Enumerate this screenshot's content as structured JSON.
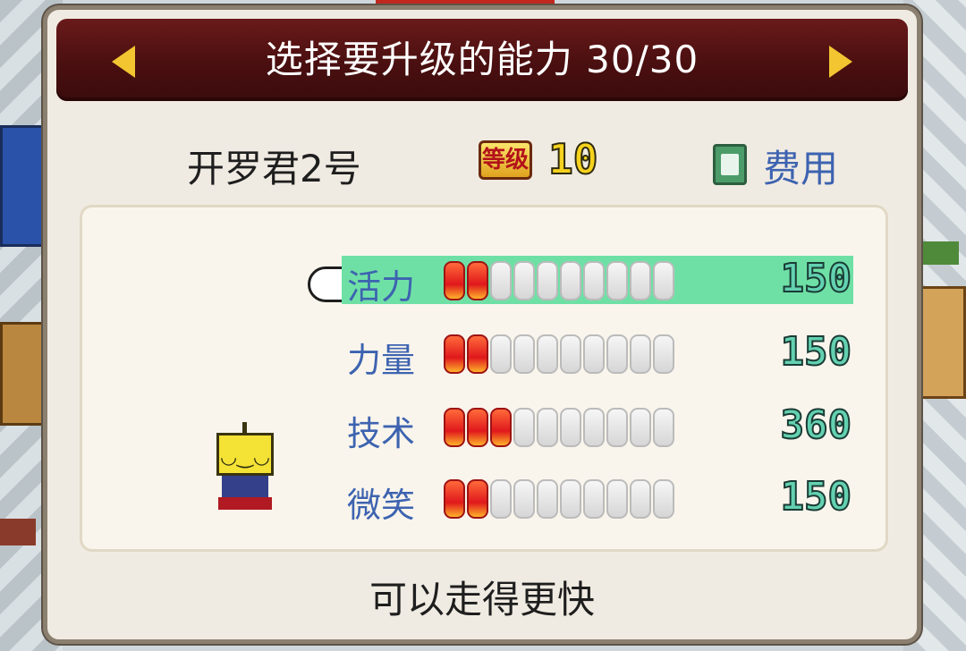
{
  "header": {
    "title": "选择要升级的能力 30/30"
  },
  "character": {
    "name": "开罗君2号",
    "level_label": "等级",
    "level": "10"
  },
  "cost": {
    "label": "费用"
  },
  "stats": [
    {
      "name": "活力",
      "filled": 2,
      "total": 10,
      "value": "150",
      "selected": true
    },
    {
      "name": "力量",
      "filled": 2,
      "total": 10,
      "value": "150",
      "selected": false
    },
    {
      "name": "技术",
      "filled": 3,
      "total": 10,
      "value": "360",
      "selected": false
    },
    {
      "name": "微笑",
      "filled": 2,
      "total": 10,
      "value": "150",
      "selected": false
    }
  ],
  "description": "可以走得更快",
  "colors": {
    "title_bar": "#4a0f10",
    "selected_row": "#6fe0a5",
    "stat_label": "#3d63b0",
    "value_fill": "#63d1b0",
    "bar_on": "#e0181c"
  }
}
